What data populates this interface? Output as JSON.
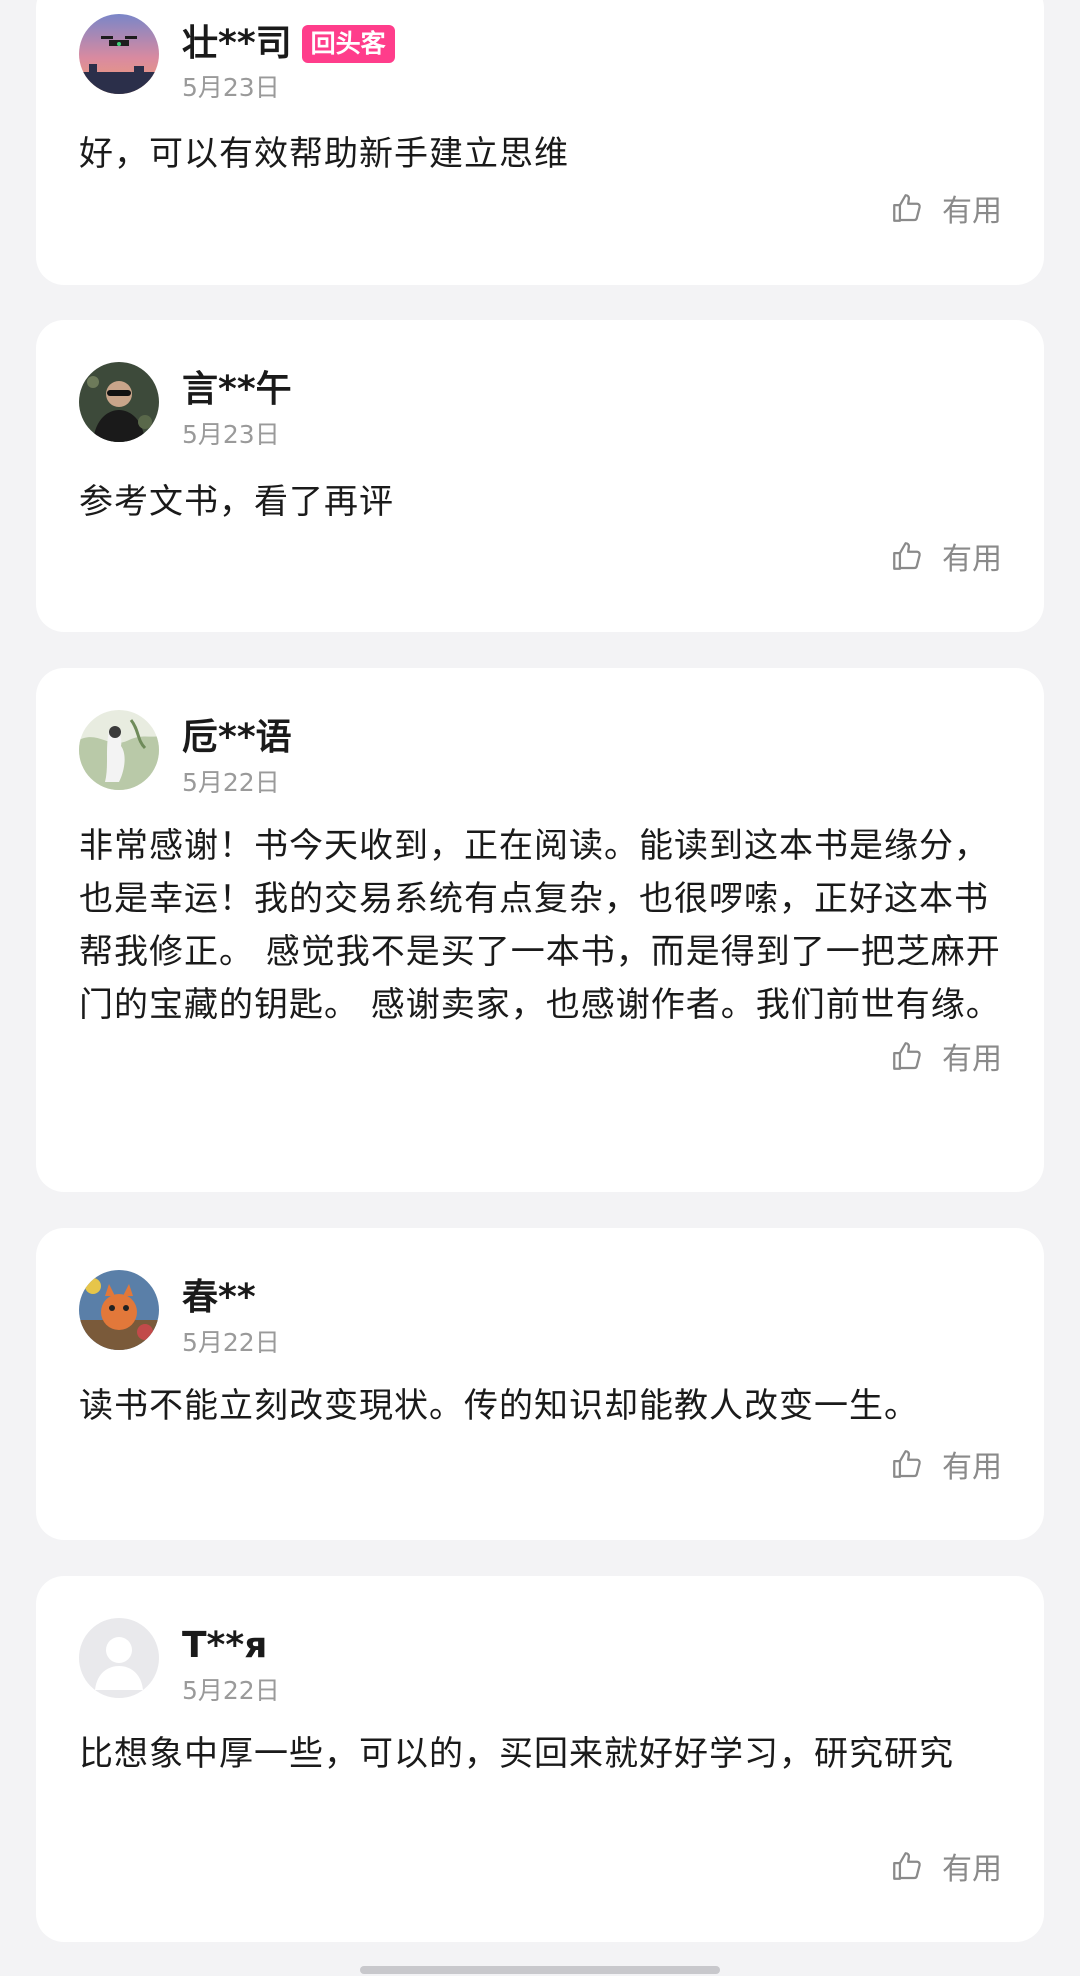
{
  "reviews": [
    {
      "username": "壮**司",
      "badge": "回头客",
      "date": "5月23日",
      "content": "好，可以有效帮助新手建立思维",
      "useful_label": "有用",
      "avatar": "drone-sunset-avatar"
    },
    {
      "username": "言**午",
      "date": "5月23日",
      "content": "参考文书，看了再评",
      "useful_label": "有用",
      "avatar": "person-avatar"
    },
    {
      "username": "卮**语",
      "date": "5月22日",
      "content": "非常感谢！书今天收到，正在阅读。能读到这本书是缘分，也是幸运！我的交易系统有点复杂，也很啰嗦，正好这本书帮我修正。 感觉我不是买了一本书，而是得到了一把芝麻开门的宝藏的钥匙。 感谢卖家，也感谢作者。我们前世有缘。",
      "useful_label": "有用",
      "avatar": "painting-avatar"
    },
    {
      "username": "春**",
      "date": "5月22日",
      "content": "读书不能立刻改变現状。传的知识却能教人改变一生。",
      "useful_label": "有用",
      "avatar": "cartoon-avatar"
    },
    {
      "username": "T**я",
      "date": "5月22日",
      "content": "比想象中厚一些，可以的，买回来就好好学习，研究研究",
      "useful_label": "有用",
      "avatar": "default-user-avatar"
    }
  ],
  "colors": {
    "background": "#f3f3f5",
    "card": "#ffffff",
    "badge": "#ff3d8b",
    "secondary_text": "#9a9a9a"
  }
}
